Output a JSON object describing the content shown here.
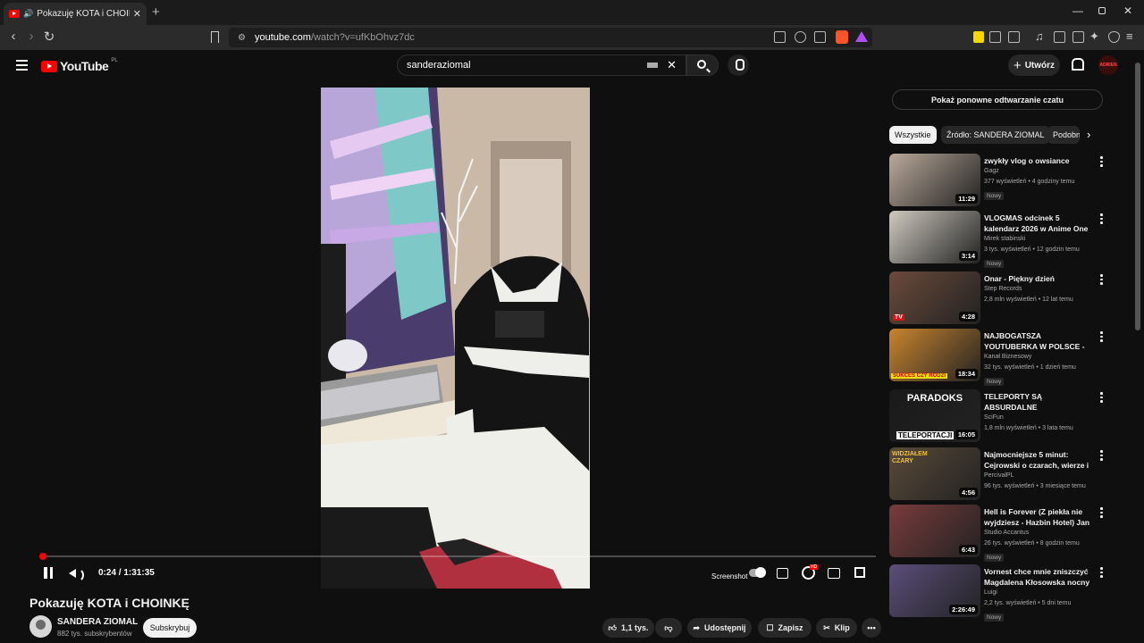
{
  "browser": {
    "tab_title": "Pokazuję KOTA i CHOINKĘ - Y",
    "url_host": "youtube.com",
    "url_path": "/watch?v=ufKbOhvz7dc"
  },
  "header": {
    "logo_text": "YouTube",
    "logo_region": "PL",
    "search_query": "sanderaziomal",
    "create_label": "Utwórz",
    "avatar_text": "ADRIEN"
  },
  "player": {
    "time": "0:24 / 1:31:35",
    "progress_fraction": 0.0044,
    "screenshot_label": "Screenshot"
  },
  "video": {
    "title": "Pokazuję KOTA i CHOINKĘ",
    "channel": "SANDERA ZIOMAL",
    "subscribers": "882 tys. subskrybentów",
    "subscribe_label": "Subskrybuj",
    "likes": "1,1 tys.",
    "share_label": "Udostępnij",
    "save_label": "Zapisz",
    "clip_label": "Klip"
  },
  "sidebar": {
    "chat_replay": "Pokaż ponowne odtwarzanie czatu",
    "chips": [
      "Wszystkie",
      "Źródło: SANDERA ZIOMAL",
      "Podobne"
    ],
    "recs": [
      {
        "title": "zwykły vlog o owsiance",
        "channel": "Gagz",
        "meta": "377 wyświetleń • 4 godziny temu",
        "badge": "Nowy",
        "duration": "11:29",
        "color": "#b9a99a"
      },
      {
        "title": "VLOGMAS odcinek 5 kalendarz 2026 w Anime One Piece ...",
        "channel": "Mirek stabinski",
        "meta": "3 tys. wyświetleń • 12 godzin temu",
        "badge": "Nowy",
        "duration": "3:14",
        "color": "#cfcac0"
      },
      {
        "title": "Onar - Piękny dzień",
        "channel": "Step Records",
        "meta": "2,8 mln wyświetleń • 12 lat temu",
        "badge": "",
        "duration": "4:28",
        "color": "#6b4a3a"
      },
      {
        "title": "NAJBOGATSZA YOUTUBERKA W POLSCE - JAK POWSTAŁA ...",
        "channel": "Kanał Biznesowy",
        "meta": "32 tys. wyświetleń • 1 dzień temu",
        "badge": "Nowy",
        "duration": "18:34",
        "color": "#c9842e"
      },
      {
        "title": "TELEPORTY SĄ ABSURDALNE",
        "channel": "SciFun",
        "meta": "1,8 mln wyświetleń • 3 lata temu",
        "badge": "",
        "duration": "16:05",
        "color": "#1a1a1a"
      },
      {
        "title": "Najmocniejsze 5 minut: Cejrowski o czarach, wierze i ...",
        "channel": "PercivalPL",
        "meta": "96 tys. wyświetleń • 3 miesiące temu",
        "badge": "",
        "duration": "4:56",
        "color": "#5a4a38"
      },
      {
        "title": "Hell is Forever (Z piekła nie wyjdziesz - Hazbin Hotel) Jan ...",
        "channel": "Studio Accantus",
        "meta": "26 tys. wyświetleń • 8 godzin temu",
        "badge": "Nowy",
        "duration": "6:43",
        "color": "#7a3b3b"
      },
      {
        "title": "Vornest chce mnie zniszczyć Magdalena Kłosowska nocny ...",
        "channel": "Luigi",
        "meta": "2,2 tys. wyświetleń • 5 dni temu",
        "badge": "Nowy",
        "duration": "2:26:49",
        "color": "#5b4e7a"
      }
    ],
    "thumb_texts": {
      "teleport_top": "PARADOKS",
      "teleport_bottom": "TELEPORTACJI",
      "czary": "WIDZIAŁEM CZARY",
      "bogata": "SUKCES CZY RODZI"
    }
  }
}
